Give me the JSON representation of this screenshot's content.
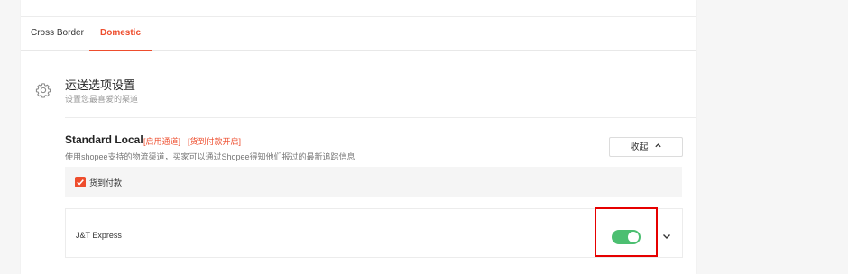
{
  "tabs": [
    {
      "label": "Cross Border",
      "active": false
    },
    {
      "label": "Domestic",
      "active": true
    }
  ],
  "section": {
    "title": "运送选项设置",
    "subtitle": "设置您最喜爱的渠道",
    "icon": "gear-icon"
  },
  "channel": {
    "title": "Standard Local",
    "tag_enabled": "[启用通道]",
    "tag_cod": "[货到付款开启]",
    "description": "使用shopee支持的物流渠道，买家可以通过Shopee得知他们报过的最新追踪信息",
    "collapse_label": "收起",
    "cod_checkbox_label": "货到付款",
    "cod_checked": true
  },
  "courier": {
    "name": "J&T Express",
    "enabled": true
  },
  "colors": {
    "accent": "#ee4d2d",
    "toggle_on": "#4cbf71",
    "highlight": "#e60000"
  }
}
